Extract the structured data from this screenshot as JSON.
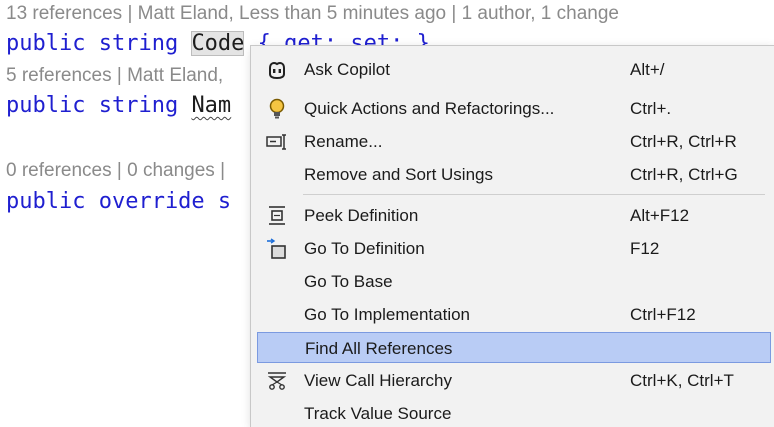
{
  "editor": {
    "lens1": "13 references | Matt Eland, Less than 5 minutes ago | 1 author, 1 change",
    "line1": {
      "kw": "public string ",
      "ident": "Code",
      "rest": " { get; set; }"
    },
    "lens2": "5 references | Matt Eland,",
    "line2": {
      "kw": "public string ",
      "ident": "Nam"
    },
    "lens3": "0 references | 0 changes |",
    "line3": {
      "kw": "public override s"
    }
  },
  "menu": {
    "items": [
      {
        "label": "Ask Copilot",
        "shortcut": "Alt+/",
        "icon": "copilot-icon"
      },
      {
        "label": "Quick Actions and Refactorings...",
        "shortcut": "Ctrl+.",
        "icon": "lightbulb-icon"
      },
      {
        "label": "Rename...",
        "shortcut": "Ctrl+R, Ctrl+R",
        "icon": "rename-icon"
      },
      {
        "label": "Remove and Sort Usings",
        "shortcut": "Ctrl+R, Ctrl+G",
        "icon": ""
      },
      {
        "label": "Peek Definition",
        "shortcut": "Alt+F12",
        "icon": "peek-definition-icon"
      },
      {
        "label": "Go To Definition",
        "shortcut": "F12",
        "icon": "go-to-definition-icon"
      },
      {
        "label": "Go To Base",
        "shortcut": "",
        "icon": ""
      },
      {
        "label": "Go To Implementation",
        "shortcut": "Ctrl+F12",
        "icon": ""
      },
      {
        "label": "Find All References",
        "shortcut": "",
        "icon": "",
        "highlighted": true
      },
      {
        "label": "View Call Hierarchy",
        "shortcut": "Ctrl+K, Ctrl+T",
        "icon": "call-hierarchy-icon"
      },
      {
        "label": "Track Value Source",
        "shortcut": "",
        "icon": ""
      }
    ]
  },
  "colors": {
    "keyword": "#1f1fd0",
    "highlight": "#b9ccf5",
    "lens_text": "#8a8a8a"
  }
}
